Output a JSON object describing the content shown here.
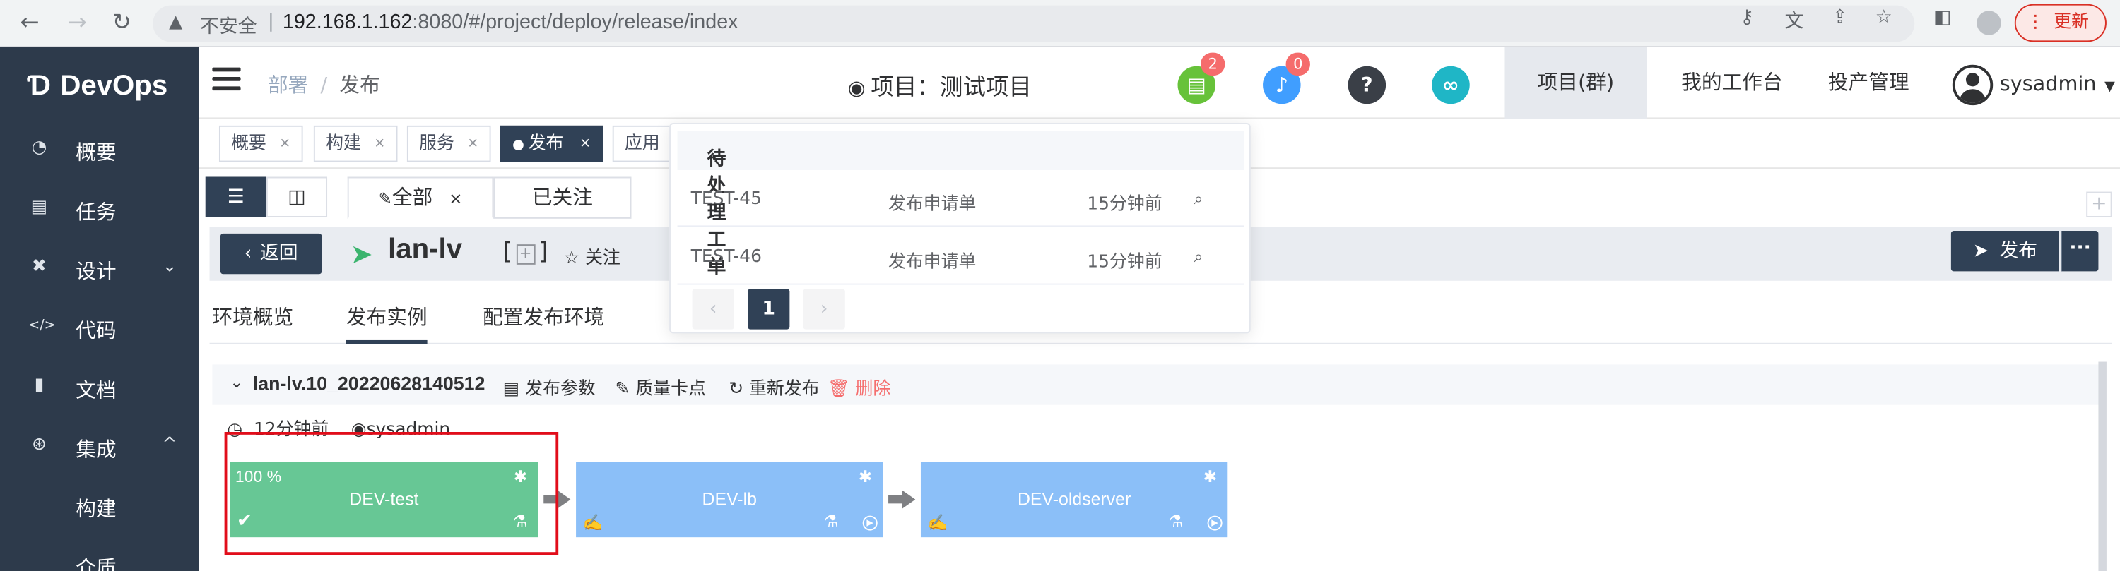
{
  "browser": {
    "insecure_label": "不安全",
    "url_host": "192.168.1.162",
    "url_rest": ":8080/#/project/deploy/release/index",
    "update_label": "更新"
  },
  "sidebar": {
    "logo": "DevOps",
    "items": [
      {
        "label": "概要",
        "icon": "dashboard-icon"
      },
      {
        "label": "任务",
        "icon": "task-icon"
      },
      {
        "label": "设计",
        "icon": "design-icon"
      },
      {
        "label": "代码",
        "icon": "code-icon"
      },
      {
        "label": "文档",
        "icon": "document-icon"
      },
      {
        "label": "集成",
        "icon": "integration-icon"
      },
      {
        "label": "构建"
      },
      {
        "label": "介质"
      }
    ]
  },
  "header": {
    "breadcrumb": [
      "部署",
      "发布"
    ],
    "project_title": "项目：测试项目",
    "badge_tickets": "2",
    "badge_notifications": "0",
    "nav": [
      "项目(群)",
      "我的工作台",
      "投产管理"
    ],
    "username": "sysadmin"
  },
  "tags": [
    "概要",
    "构建",
    "服务",
    "发布",
    "应用"
  ],
  "top_tabs": [
    "全部",
    "已关注"
  ],
  "titlebar": {
    "back_label": "返回",
    "app_name": "lan-lv",
    "follow_label": "关注",
    "publish_label": "发布",
    "more_label": "···"
  },
  "sub_tabs": [
    "环境概览",
    "发布实例",
    "配置发布环境"
  ],
  "release": {
    "name": "lan-lv.10_20220628140512",
    "actions": [
      "发布参数",
      "质量卡点",
      "重新发布",
      "删除"
    ],
    "time": "12分钟前",
    "user": "sysadmin",
    "stages": [
      {
        "name": "DEV-test",
        "progress": "100 %",
        "status": "success",
        "color": "#67c795"
      },
      {
        "name": "DEV-lb",
        "status": "pending",
        "color": "#8bbff8"
      },
      {
        "name": "DEV-oldserver",
        "status": "pending",
        "color": "#8bbff8"
      }
    ]
  },
  "popover": {
    "title": "待处理工单",
    "rows": [
      {
        "id": "TEST-45",
        "type": "发布申请单",
        "time": "15分钟前"
      },
      {
        "id": "TEST-46",
        "type": "发布申请单",
        "time": "15分钟前"
      }
    ],
    "page": "1"
  },
  "colors": {
    "sidebar_bg": "#2d3a4b",
    "accent": "#304156",
    "success": "#67c795",
    "pending": "#8bbff8",
    "danger": "#f56c6c"
  }
}
